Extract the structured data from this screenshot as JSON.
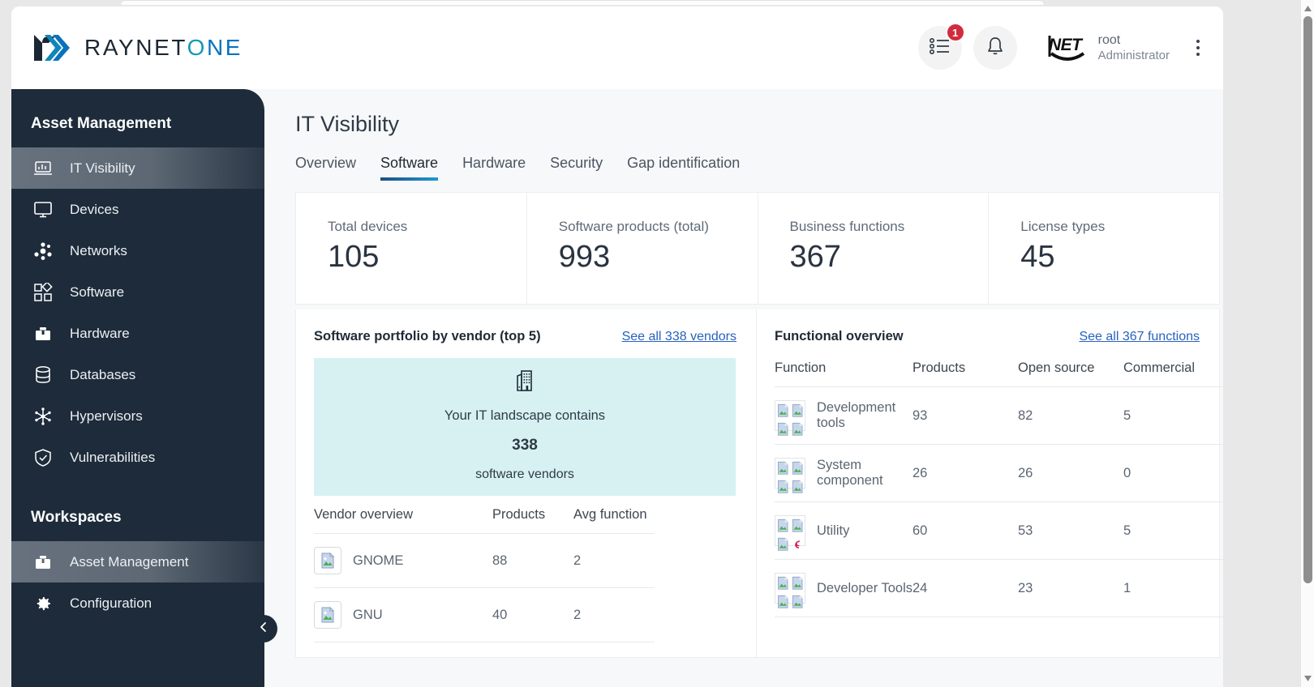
{
  "header": {
    "brand": {
      "name_1": "RAYNET",
      "name_2": "ONE"
    },
    "tasks_icon": "list-icon",
    "tasks_badge": "1",
    "bell_icon": "bell-icon",
    "avatar_text": "NET",
    "user_name": "root",
    "user_role": "Administrator",
    "menu_icon": "kebab-menu-icon"
  },
  "sidebar": {
    "section_title": "Asset Management",
    "items": [
      {
        "label": "IT Visibility",
        "icon": "laptop-chart-icon",
        "active": true
      },
      {
        "label": "Devices",
        "icon": "monitor-icon",
        "active": false
      },
      {
        "label": "Networks",
        "icon": "network-nodes-icon",
        "active": false
      },
      {
        "label": "Software",
        "icon": "blocks-icon",
        "active": false
      },
      {
        "label": "Hardware",
        "icon": "toolbox-icon",
        "active": false
      },
      {
        "label": "Databases",
        "icon": "database-icon",
        "active": false
      },
      {
        "label": "Hypervisors",
        "icon": "hypervisor-icon",
        "active": false
      },
      {
        "label": "Vulnerabilities",
        "icon": "shield-check-icon",
        "active": false
      }
    ],
    "workspaces_title": "Workspaces",
    "workspaces": [
      {
        "label": "Asset Management",
        "icon": "briefcase-icon",
        "active": true
      },
      {
        "label": "Configuration",
        "icon": "gear-icon",
        "active": false
      }
    ],
    "collapse_icon": "chevron-left-icon"
  },
  "main": {
    "page_title": "IT Visibility",
    "tabs": [
      {
        "label": "Overview",
        "active": false
      },
      {
        "label": "Software",
        "active": true
      },
      {
        "label": "Hardware",
        "active": false
      },
      {
        "label": "Security",
        "active": false
      },
      {
        "label": "Gap identification",
        "active": false
      }
    ],
    "kpis": [
      {
        "label": "Total devices",
        "value": "105"
      },
      {
        "label": "Software products (total)",
        "value": "993"
      },
      {
        "label": "Business functions",
        "value": "367"
      },
      {
        "label": "License types",
        "value": "45"
      }
    ],
    "vendor_panel": {
      "title": "Software portfolio by vendor (top 5)",
      "link": "See all 338 vendors",
      "banner": {
        "icon": "building-icon",
        "line1": "Your IT landscape contains",
        "count": "338",
        "line2": "software vendors"
      },
      "columns": [
        "Vendor overview",
        "Products",
        "Avg function"
      ],
      "rows": [
        {
          "name": "GNOME",
          "products": "88",
          "avg_functions": "2",
          "icon": "broken-image-icon"
        },
        {
          "name": "GNU",
          "products": "40",
          "avg_functions": "2",
          "icon": "broken-image-icon"
        }
      ]
    },
    "function_panel": {
      "title": "Functional overview",
      "link": "See all 367 functions",
      "columns": [
        "Function",
        "Products",
        "Open source",
        "Commercial"
      ],
      "rows": [
        {
          "name": "Development tools",
          "products": "93",
          "open_source": "82",
          "commercial": "5",
          "icon": "broken-image-grid-icon"
        },
        {
          "name": "System component",
          "products": "26",
          "open_source": "26",
          "commercial": "0",
          "icon": "broken-image-grid-icon"
        },
        {
          "name": "Utility",
          "products": "60",
          "open_source": "53",
          "commercial": "5",
          "icon": "broken-image-grid-debian-icon"
        },
        {
          "name": "Developer Tools",
          "products": "24",
          "open_source": "23",
          "commercial": "1",
          "icon": "broken-image-grid-icon"
        }
      ]
    }
  },
  "colors": {
    "sidebar_bg": "#1d2b3a",
    "link": "#2962bd",
    "badge": "#d32b3e",
    "banner_bg": "#d7f1f3",
    "tab_underline": "#2196d4",
    "brand_teal": "#1398b9",
    "brand_blue": "#0a72bd"
  }
}
